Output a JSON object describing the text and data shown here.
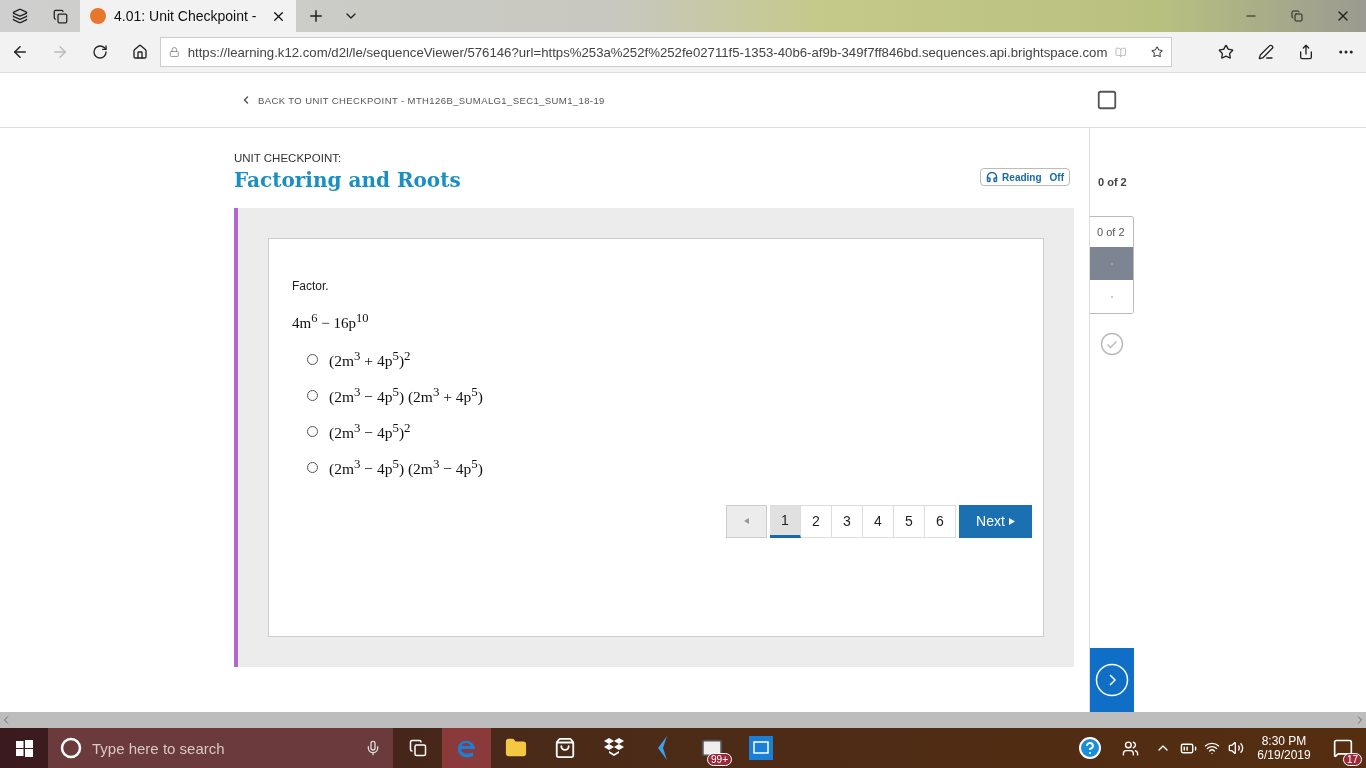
{
  "browser": {
    "tabs": [
      {
        "title": "4.01: Unit Checkpoint -",
        "selected": true
      }
    ],
    "url": "https://learning.k12.com/d2l/le/sequenceViewer/576146?url=https%253a%252f%252fe02711f5-1353-40b6-af9b-349f7ff846bd.sequences.api.brightspace.com"
  },
  "header": {
    "back_link": "BACK TO UNIT CHECKPOINT - MTH126B_SUMALG1_SEC1_SUM1_18-19"
  },
  "content": {
    "eyebrow": "UNIT CHECKPOINT:",
    "title": "Factoring and Roots",
    "reading": {
      "label": "Reading",
      "state": "Off"
    },
    "question": {
      "prompt": "Factor.",
      "expression": "4m$^{6}$ − 16p$^{10}$",
      "options": [
        {
          "text": "(2m$^{3}$ + 4p$^{5}$)$^{2}$",
          "selected": false
        },
        {
          "text": "(2m$^{3}$ − 4p$^{5}$) (2m$^{3}$ + 4p$^{5}$)",
          "selected": false
        },
        {
          "text": "(2m$^{3}$ − 4p$^{5}$)$^{2}$",
          "selected": false
        },
        {
          "text": "(2m$^{3}$ − 4p$^{5}$) (2m$^{3}$ − 4p$^{5}$)",
          "selected": false
        }
      ]
    },
    "pager": {
      "pages": [
        {
          "label": "1",
          "selected": true
        },
        {
          "label": "2",
          "selected": false
        },
        {
          "label": "3",
          "selected": false
        },
        {
          "label": "4",
          "selected": false
        },
        {
          "label": "5",
          "selected": false
        },
        {
          "label": "6",
          "selected": false
        }
      ],
      "next": "Next"
    }
  },
  "sidebar": {
    "progress": "0 of 2",
    "card_progress": "0 of 2",
    "items": [
      {
        "selected": true
      },
      {
        "selected": false
      }
    ]
  },
  "taskbar": {
    "search_placeholder": "Type here to search",
    "mail_badge": "99+",
    "time": "8:30 PM",
    "date": "6/19/2019",
    "notification_badge": "17"
  }
}
